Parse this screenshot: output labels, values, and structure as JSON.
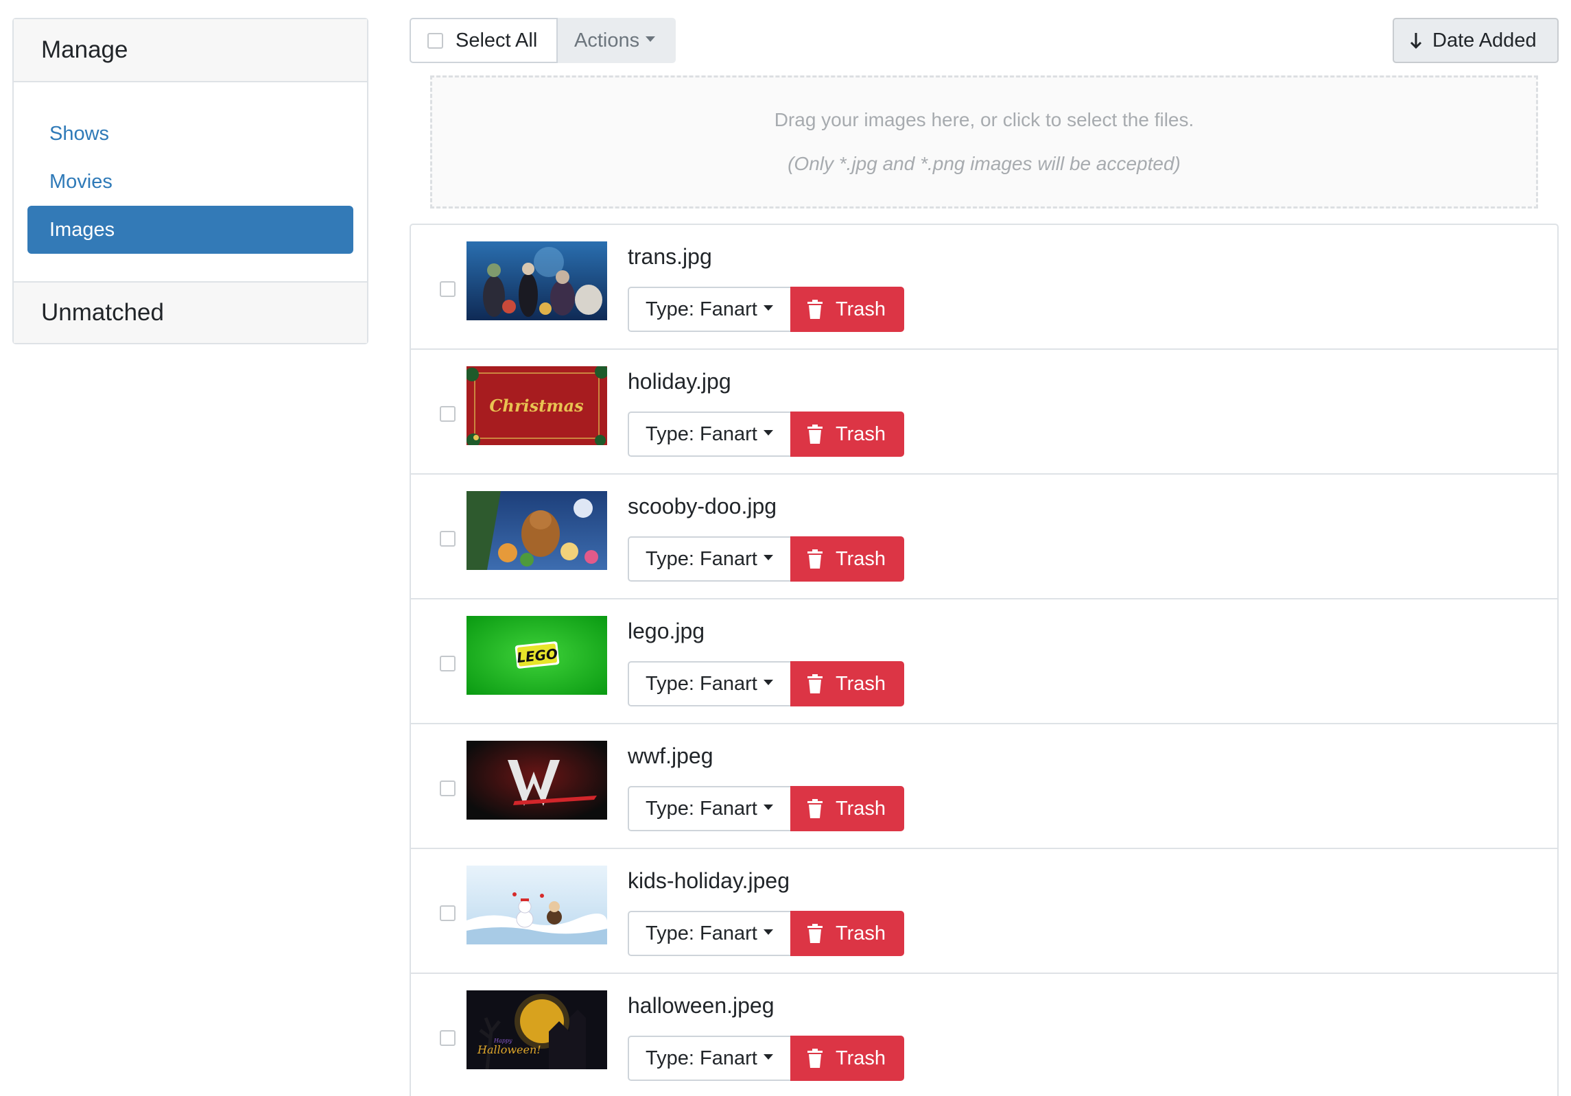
{
  "sidebar": {
    "heading": "Manage",
    "items": [
      {
        "label": "Shows",
        "active": false
      },
      {
        "label": "Movies",
        "active": false
      },
      {
        "label": "Images",
        "active": true
      }
    ],
    "footer": "Unmatched"
  },
  "toolbar": {
    "select_all_label": "Select All",
    "actions_label": "Actions",
    "sort_label": "Date Added",
    "sort_icon": "arrow-down-icon"
  },
  "dropzone": {
    "main_text": "Drag your images here, or click to select the files.",
    "sub_text": "(Only *.jpg and *.png images will be accepted)"
  },
  "images": [
    {
      "filename": "trans.jpg",
      "type_label": "Type: Fanart",
      "trash_label": "Trash",
      "thumbnail": "monster-characters-poster"
    },
    {
      "filename": "holiday.jpg",
      "type_label": "Type: Fanart",
      "trash_label": "Trash",
      "thumbnail": "christmas-card",
      "thumb_text": "Christmas"
    },
    {
      "filename": "scooby-doo.jpg",
      "type_label": "Type: Fanart",
      "trash_label": "Trash",
      "thumbnail": "cartoon-dog-poster"
    },
    {
      "filename": "lego.jpg",
      "type_label": "Type: Fanart",
      "trash_label": "Trash",
      "thumbnail": "lego-logo",
      "thumb_text": "LEGO"
    },
    {
      "filename": "wwf.jpeg",
      "type_label": "Type: Fanart",
      "trash_label": "Trash",
      "thumbnail": "wrestling-logo"
    },
    {
      "filename": "kids-holiday.jpeg",
      "type_label": "Type: Fanart",
      "trash_label": "Trash",
      "thumbnail": "snowmen-scene"
    },
    {
      "filename": "halloween.jpeg",
      "type_label": "Type: Fanart",
      "trash_label": "Trash",
      "thumbnail": "haunted-house",
      "thumb_text": "Halloween!",
      "thumb_text_small": "Happy"
    }
  ],
  "colors": {
    "primary": "#337ab7",
    "link": "#2f7ab8",
    "danger": "#dc3545",
    "muted": "#6c757d",
    "border": "#dee2e6"
  }
}
